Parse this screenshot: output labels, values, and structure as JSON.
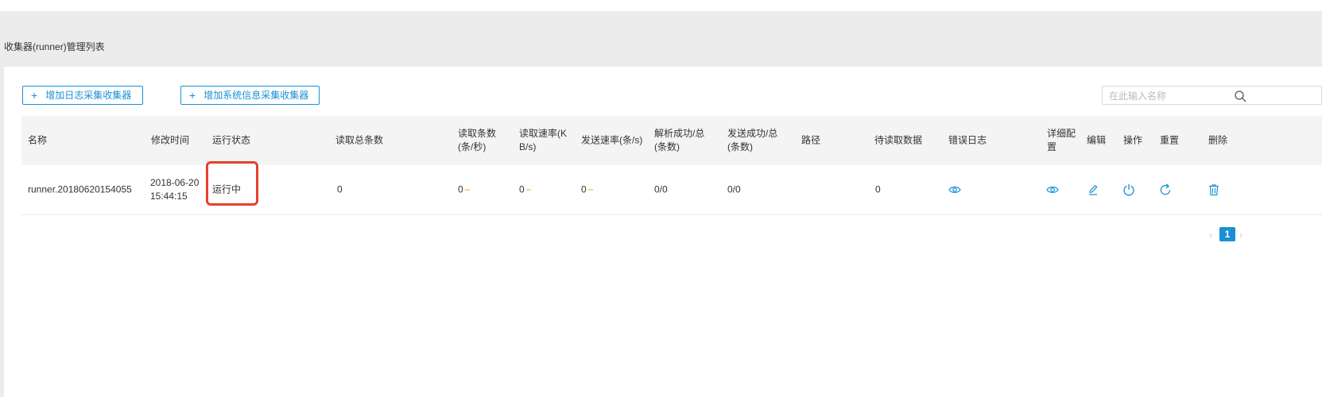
{
  "page": {
    "title": "收集器(runner)管理列表"
  },
  "toolbar": {
    "add_log_collector_label": "增加日志采集收集器",
    "add_system_collector_label": "增加系统信息采集收集器",
    "plus_glyph": "+",
    "search_placeholder": "在此输入名称"
  },
  "table": {
    "headers": {
      "name": "名称",
      "modified_time": "修改时间",
      "run_status": "运行状态",
      "read_total": "读取总条数",
      "read_count_rate": "读取条数(条/秒)",
      "read_speed": "读取速率(KB/s)",
      "send_rate": "发送速率(条/s)",
      "parse_success_total": "解析成功/总(条数)",
      "send_success_total": "发送成功/总(条数)",
      "path": "路径",
      "pending_data": "待读取数据",
      "error_log": "错误日志",
      "detail_config": "详细配置",
      "edit": "编辑",
      "operate": "操作",
      "reset": "重置",
      "delete": "删除"
    },
    "rows": [
      {
        "name": "runner.20180620154055",
        "modified_date": "2018-06-20",
        "modified_clock": "15:44:15",
        "run_status": "运行中",
        "read_total": "0",
        "read_count_rate": "0",
        "read_speed": "0",
        "send_rate": "0",
        "parse_success_total": "0/0",
        "send_success_total": "0/0",
        "path": "",
        "pending_data": "0"
      }
    ]
  },
  "pagination": {
    "prev_glyph": "‹",
    "current_page": "1",
    "next_glyph": "›"
  },
  "colors": {
    "accent": "#1890d5",
    "highlight_border": "#e5412d",
    "trend_dash": "#f5a623",
    "header_bg": "#f4f4f4",
    "band_bg": "#ececec"
  },
  "icons": {
    "search": "search-icon",
    "error_log_view": "eye-icon",
    "detail_view": "eye-icon",
    "edit": "pencil-icon",
    "operate": "power-icon",
    "reset": "refresh-icon",
    "delete": "trash-icon"
  }
}
